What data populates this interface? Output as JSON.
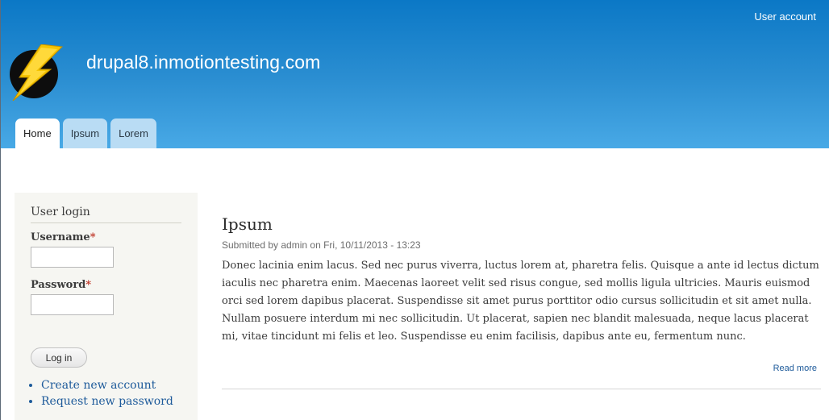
{
  "header": {
    "user_account": "User account",
    "site_name": "drupal8.inmotiontesting.com",
    "logo_icon": "lightning-bolt-icon",
    "colors": {
      "gradient_top": "#0b78c6",
      "gradient_bottom": "#48a9e6"
    }
  },
  "nav": {
    "tabs": [
      {
        "label": "Home",
        "active": true
      },
      {
        "label": "Ipsum",
        "active": false
      },
      {
        "label": "Lorem",
        "active": false
      }
    ]
  },
  "sidebar": {
    "title": "User login",
    "username_label": "Username",
    "password_label": "Password",
    "required_marker": "*",
    "login_button": "Log in",
    "links": [
      "Create new account",
      "Request new password"
    ]
  },
  "article": {
    "title": "Ipsum",
    "submitted": "Submitted by admin on Fri, 10/11/2013 - 13:23",
    "body": "Donec lacinia enim lacus. Sed nec purus viverra, luctus lorem at, pharetra felis. Quisque a ante id lectus dictum iaculis nec pharetra enim. Maecenas laoreet velit sed risus congue, sed mollis ligula ultricies. Mauris euismod orci sed lorem dapibus placerat. Suspendisse sit amet purus porttitor odio cursus sollicitudin et sit amet nulla. Nullam posuere interdum mi nec sollicitudin. Ut placerat, sapien nec blandit malesuada, neque lacus placerat mi, vitae tincidunt mi felis et leo. Suspendisse eu enim facilisis, dapibus ante eu, fermentum nunc.",
    "read_more": "Read more"
  }
}
